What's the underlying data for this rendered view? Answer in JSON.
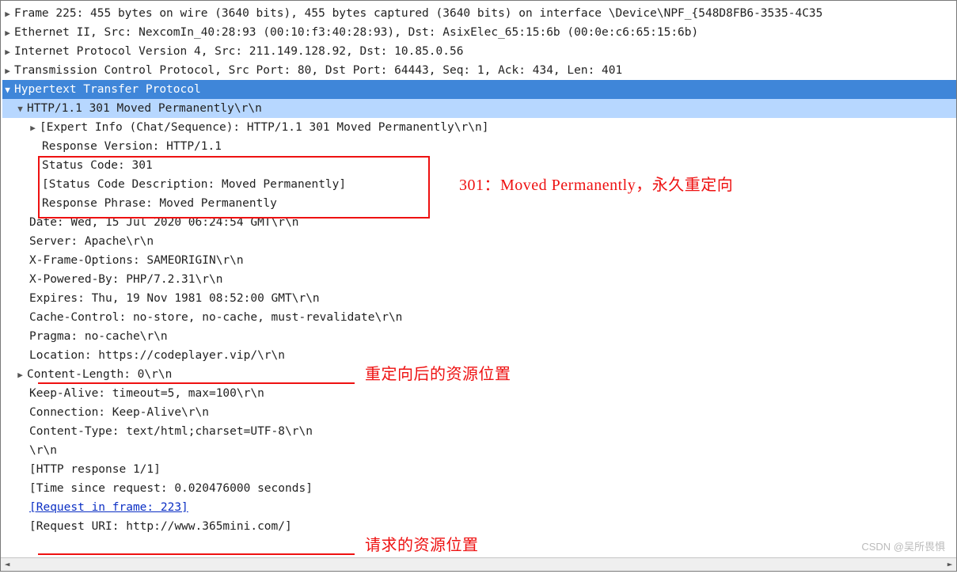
{
  "lines": {
    "frame": "Frame 225: 455 bytes on wire (3640 bits), 455 bytes captured (3640 bits) on interface \\Device\\NPF_{548D8FB6-3535-4C35",
    "eth": "Ethernet II, Src: NexcomIn_40:28:93 (00:10:f3:40:28:93), Dst: AsixElec_65:15:6b (00:0e:c6:65:15:6b)",
    "ip": "Internet Protocol Version 4, Src: 211.149.128.92, Dst: 10.85.0.56",
    "tcp": "Transmission Control Protocol, Src Port: 80, Dst Port: 64443, Seq: 1, Ack: 434, Len: 401",
    "http": "Hypertext Transfer Protocol",
    "statusline": "HTTP/1.1 301 Moved Permanently\\r\\n",
    "expert": "[Expert Info (Chat/Sequence): HTTP/1.1 301 Moved Permanently\\r\\n]",
    "respver": "Response Version: HTTP/1.1",
    "statuscode": "Status Code: 301",
    "statusdesc": "[Status Code Description: Moved Permanently]",
    "respphrase": "Response Phrase: Moved Permanently",
    "date": "Date: Wed, 15 Jul 2020 06:24:54 GMT\\r\\n",
    "server": "Server: Apache\\r\\n",
    "xframe": "X-Frame-Options: SAMEORIGIN\\r\\n",
    "xpow": "X-Powered-By: PHP/7.2.31\\r\\n",
    "expires": "Expires: Thu, 19 Nov 1981 08:52:00 GMT\\r\\n",
    "cachectl": "Cache-Control: no-store, no-cache, must-revalidate\\r\\n",
    "pragma": "Pragma: no-cache\\r\\n",
    "location": "Location: https://codeplayer.vip/\\r\\n",
    "contentlen": "Content-Length: 0\\r\\n",
    "keepalive": "Keep-Alive: timeout=5, max=100\\r\\n",
    "connection": "Connection: Keep-Alive\\r\\n",
    "ctype": "Content-Type: text/html;charset=UTF-8\\r\\n",
    "crlf": "\\r\\n",
    "httpresp": "[HTTP response 1/1]",
    "timesince": "[Time since request: 0.020476000 seconds]",
    "reqinframe": "[Request in frame: 223]",
    "requri": "[Request URI: http://www.365mini.com/]"
  },
  "annot": {
    "box1_label": "301：Moved Permanently，永久重定向",
    "label2": "重定向后的资源位置",
    "label3": "请求的资源位置"
  },
  "watermark": "CSDN @吴所畏惧",
  "scroll_left": "◄",
  "scroll_right": "►"
}
